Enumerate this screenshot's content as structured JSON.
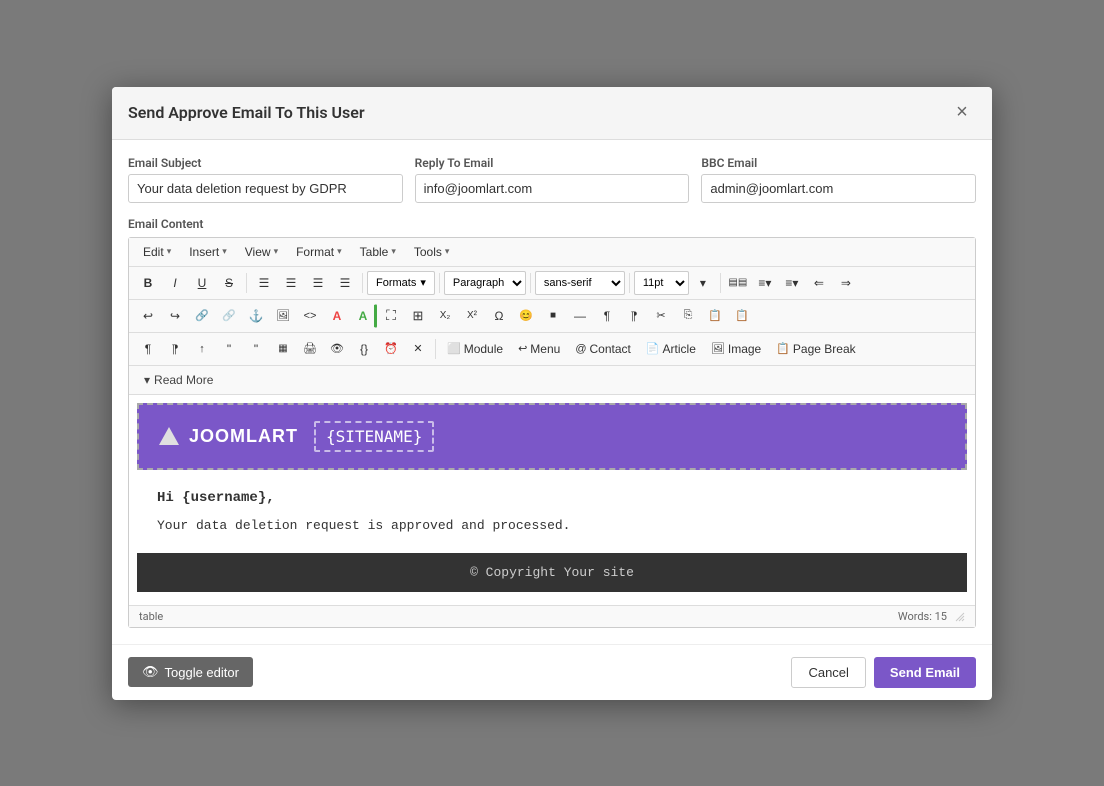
{
  "modal": {
    "title": "Send Approve Email To This User",
    "close_label": "×"
  },
  "form": {
    "subject_label": "Email Subject",
    "subject_value": "Your data deletion request by GDPR",
    "reply_label": "Reply To Email",
    "reply_value": "info@joomlart.com",
    "bcc_label": "BBC Email",
    "bcc_value": "admin@joomlart.com",
    "content_label": "Email Content"
  },
  "editor": {
    "menus": {
      "edit": "Edit",
      "insert": "Insert",
      "view": "View",
      "format": "Format",
      "table": "Table",
      "tools": "Tools"
    },
    "formats_btn": "Formats",
    "paragraph_select": "Paragraph",
    "font_select": "sans-serif",
    "size_select": "11pt",
    "read_more": "Read More"
  },
  "email_content": {
    "logo_text": "JOOMLART",
    "sitename": "{SITENAME}",
    "greeting": "Hi {username},",
    "message": "Your data deletion request is approved and processed.",
    "footer": "© Copyright Your site"
  },
  "statusbar": {
    "path": "table",
    "word_count": "Words: 15"
  },
  "buttons": {
    "toggle_editor": "Toggle editor",
    "cancel": "Cancel",
    "send_email": "Send Email"
  },
  "toolbar": {
    "bold": "B",
    "italic": "I",
    "underline": "U",
    "strikethrough": "S",
    "align_left": "≡",
    "align_center": "≡",
    "align_right": "≡",
    "align_justify": "≡",
    "undo": "↩",
    "redo": "↪",
    "link": "🔗",
    "unlink": "🔗",
    "anchor": "⚓",
    "image": "🖼",
    "code": "<>",
    "font_color": "A",
    "highlight": "A",
    "fullscreen": "⛶",
    "table_icon": "⊞",
    "subscript": "x₂",
    "superscript": "x²",
    "omega": "Ω",
    "emoji": "😊",
    "special": "■",
    "hr": "—",
    "para_ltr": "¶",
    "para_rtl": "¶",
    "cut": "✂",
    "copy": "⎘",
    "paste": "📋",
    "paste2": "📋",
    "p_tag": "¶",
    "p_tag2": "¶",
    "upload": "↑",
    "blockquote_open": "❝",
    "blockquote_close": "❞",
    "char_map": "▦",
    "print": "🖨",
    "preview": "👁",
    "code_block": "{}",
    "timer": "⏰",
    "remove_format": "✕",
    "module_label": "Module",
    "menu_label": "Menu",
    "contact_label": "Contact",
    "article_label": "Article",
    "image_label": "Image",
    "page_break_label": "Page Break"
  }
}
